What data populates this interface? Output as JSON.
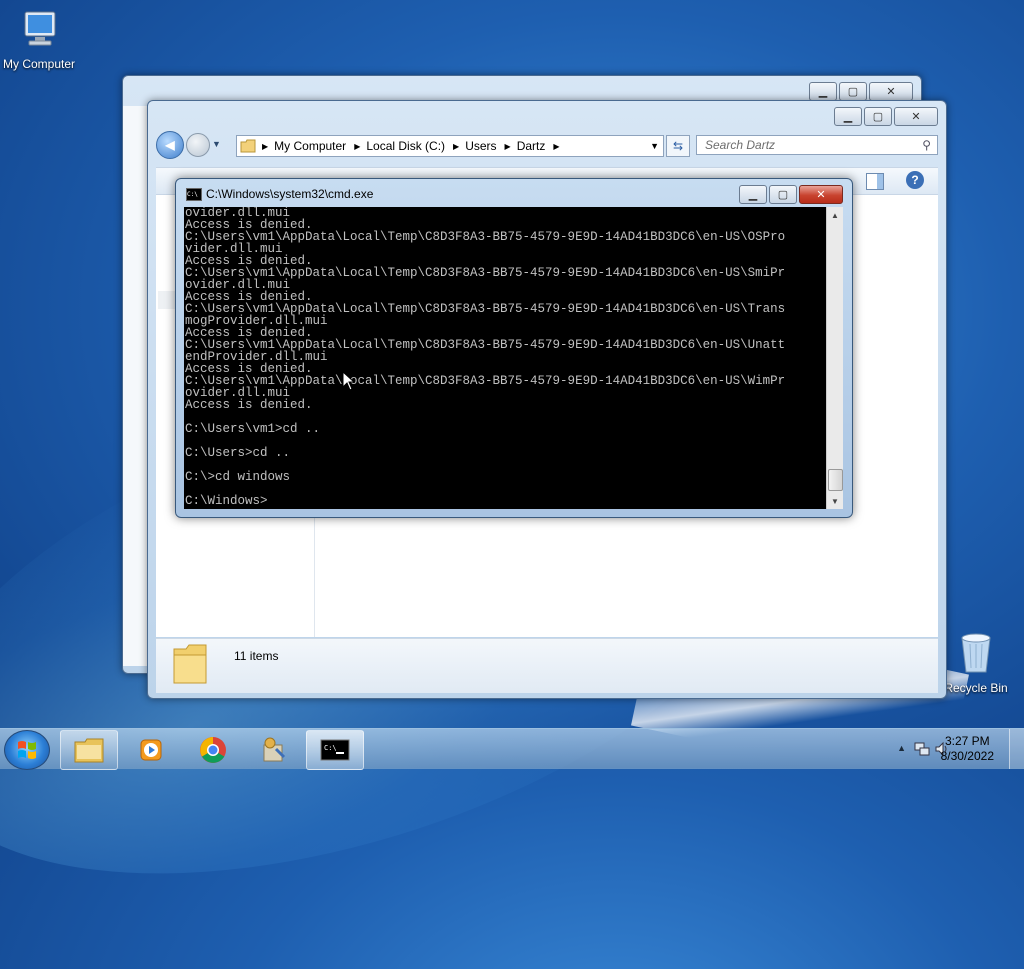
{
  "desktop": {
    "icons": [
      {
        "label": "My Computer"
      },
      {
        "label": "Recycle Bin"
      }
    ]
  },
  "explorer": {
    "breadcrumb": [
      "My Computer",
      "Local Disk (C:)",
      "Users",
      "Dartz"
    ],
    "search_placeholder": "Search Dartz",
    "status_text": "11 items"
  },
  "cmd": {
    "title": "C:\\Windows\\system32\\cmd.exe",
    "lines": [
      "ovider.dll.mui",
      "Access is denied.",
      "C:\\Users\\vm1\\AppData\\Local\\Temp\\C8D3F8A3-BB75-4579-9E9D-14AD41BD3DC6\\en-US\\OSPro",
      "vider.dll.mui",
      "Access is denied.",
      "C:\\Users\\vm1\\AppData\\Local\\Temp\\C8D3F8A3-BB75-4579-9E9D-14AD41BD3DC6\\en-US\\SmiPr",
      "ovider.dll.mui",
      "Access is denied.",
      "C:\\Users\\vm1\\AppData\\Local\\Temp\\C8D3F8A3-BB75-4579-9E9D-14AD41BD3DC6\\en-US\\Trans",
      "mogProvider.dll.mui",
      "Access is denied.",
      "C:\\Users\\vm1\\AppData\\Local\\Temp\\C8D3F8A3-BB75-4579-9E9D-14AD41BD3DC6\\en-US\\Unatt",
      "endProvider.dll.mui",
      "Access is denied.",
      "C:\\Users\\vm1\\AppData\\Local\\Temp\\C8D3F8A3-BB75-4579-9E9D-14AD41BD3DC6\\en-US\\WimPr",
      "ovider.dll.mui",
      "Access is denied.",
      "",
      "C:\\Users\\vm1>cd ..",
      "",
      "C:\\Users>cd ..",
      "",
      "C:\\>cd windows",
      "",
      "C:\\Windows>"
    ]
  },
  "taskbar": {
    "time": "3:27 PM",
    "date": "8/30/2022",
    "buttons": [
      "start-button",
      "explorer",
      "media-player",
      "chrome",
      "tools",
      "cmd"
    ]
  },
  "colors": {
    "console_bg": "#000000",
    "console_fg": "#c0c0c0",
    "desktop": "#1e5fb0"
  }
}
